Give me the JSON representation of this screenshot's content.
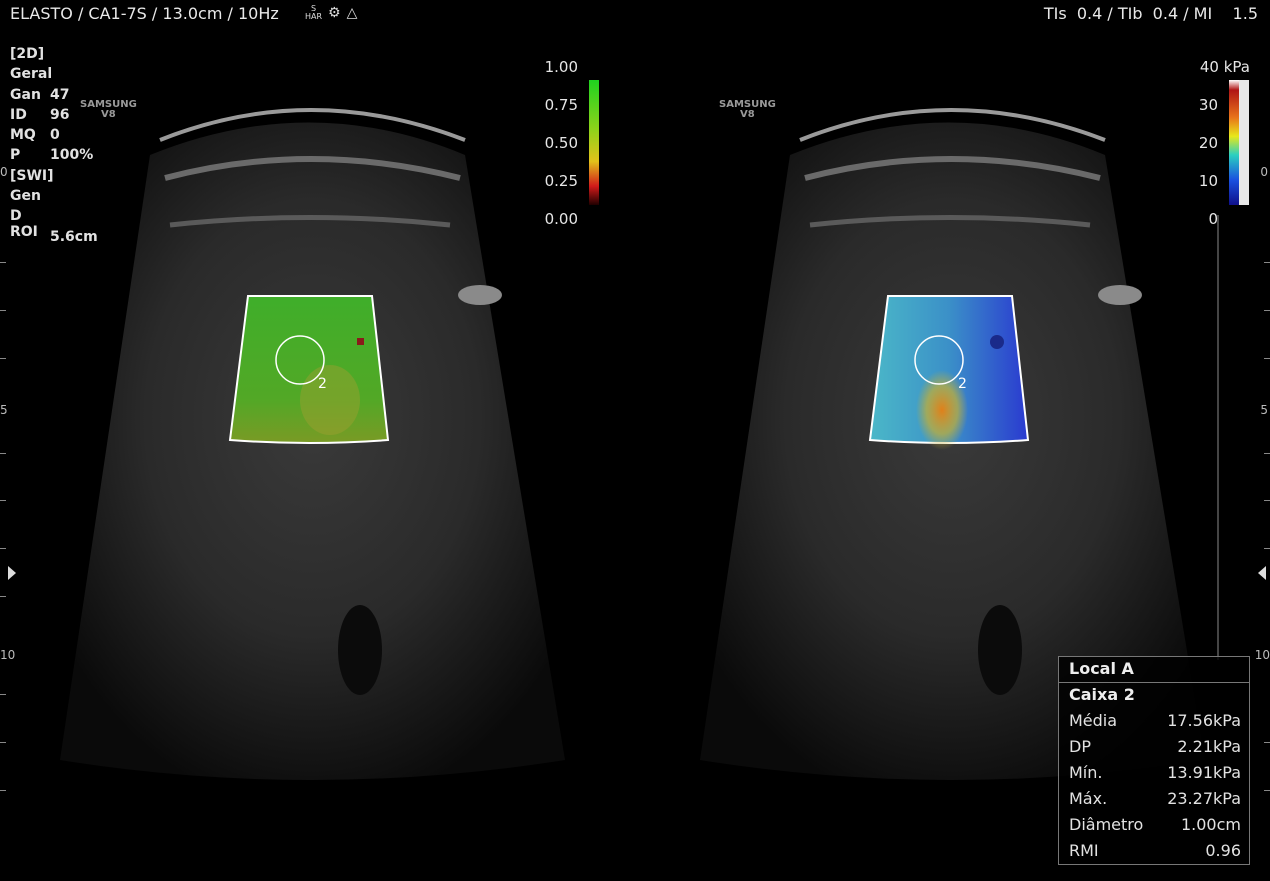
{
  "header": {
    "left": "ELASTO / CA1-7S / 13.0cm / 10Hz",
    "icon_s": "S",
    "icon_har": "HAR",
    "right": "TIs  0.4 / TIb  0.4 / MI    1.5"
  },
  "params": [
    {
      "k": "[2D]",
      "v": ""
    },
    {
      "k": "Geral",
      "v": ""
    },
    {
      "k": "Gan",
      "v": "47"
    },
    {
      "k": "ID",
      "v": "96"
    },
    {
      "k": "MQ",
      "v": "0"
    },
    {
      "k": "P",
      "v": "100%"
    },
    {
      "k": "[SWI]",
      "v": ""
    },
    {
      "k": "Gen",
      "v": ""
    },
    {
      "k": "D ROI",
      "v": ""
    },
    {
      "k": "",
      "v": "5.6cm"
    }
  ],
  "logo": {
    "brand": "SAMSUNG",
    "model": "V8"
  },
  "quality_scale": {
    "labels": [
      "1.00",
      "0.75",
      "0.50",
      "0.25",
      "0.00"
    ]
  },
  "kpa_scale": {
    "unit": "40 kPa",
    "labels": [
      "30",
      "20",
      "10",
      "0"
    ]
  },
  "depth_marks": {
    "left_5": "5",
    "left_10": "10",
    "right_0": "0",
    "right_5": "5",
    "right_10": "10",
    "top_left_0": "0"
  },
  "roi_label": "2",
  "measurement": {
    "title": "Local A",
    "subtitle": "Caixa 2",
    "rows": [
      {
        "label": "Média",
        "value": "17.56kPa"
      },
      {
        "label": "DP",
        "value": "2.21kPa"
      },
      {
        "label": "Mín.",
        "value": "13.91kPa"
      },
      {
        "label": "Máx.",
        "value": "23.27kPa"
      },
      {
        "label": "Diâmetro",
        "value": "1.00cm"
      },
      {
        "label": "RMI",
        "value": "0.96"
      }
    ]
  }
}
